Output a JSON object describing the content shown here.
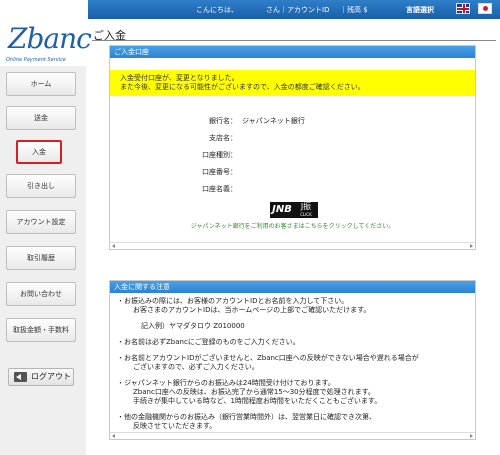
{
  "header": {
    "greeting": "こんにちは、",
    "user": "さん｜アカウントID",
    "balance": "｜残高 $",
    "language_label": "言語選択"
  },
  "logo": {
    "name": "Zbanc",
    "tagline": "Online Payment Service"
  },
  "sidebar": {
    "items": [
      {
        "label": "ホーム"
      },
      {
        "label": "送金"
      },
      {
        "label": "入金"
      },
      {
        "label": "引き出し"
      },
      {
        "label": "アカウント設定"
      },
      {
        "label": "取引履歴"
      },
      {
        "label": "お問い合わせ"
      },
      {
        "label": "取扱金額・手数料"
      }
    ],
    "logout_label": "ログアウト"
  },
  "page_title": "ご入金",
  "deposit_panel": {
    "header": "ご入金口座",
    "notice_line1": "入金受付口座が、変更となりました。",
    "notice_line2": "また今後、変更になる可能性がございますので、入金の都度ご確認ください。",
    "fields": [
      {
        "label": "銀行名：",
        "value": "ジャパンネット銀行"
      },
      {
        "label": "支店名：",
        "value": ""
      },
      {
        "label": "口座種別：",
        "value": ""
      },
      {
        "label": "口座番号：",
        "value": ""
      },
      {
        "label": "口座名義：",
        "value": ""
      }
    ],
    "bank_logo": "JNB",
    "bank_logo_sub": "J振",
    "bank_logo_click": "CLICK",
    "bank_link_text": "ジャパンネット銀行をご利用のお客さまはこちらをクリックしてください。"
  },
  "notes_panel": {
    "header": "入金に関する注意",
    "lines": [
      "・お振込みの際には、お客様のアカウントIDとお名前を入力して下さい。",
      "お客さまのアカウントIDは、当ホームページの上部でご確認いただけます。",
      "記入例）ヤマダタロウ Z010000",
      "・お名前は必ずZbancにご登録のものをご入力ください。",
      "・お名前とアカウントIDがございませんと、Zbanc口座への反映ができない場合や遅れる場合が",
      "ございますので、必ずご入力ください。",
      "・ジャパンネット銀行からのお振込みは24時間受け付けております。",
      "Zbanc口座への反映は、お振込完了から通常15〜30分程度で処理されます。",
      "手続きが集中している時など、1時間程度お時間をいただくこともございます。",
      "・他の金融機関からのお振込み（銀行営業時間外）は、翌営業日に確認でき次第、",
      "反映させていただきます。"
    ]
  }
}
